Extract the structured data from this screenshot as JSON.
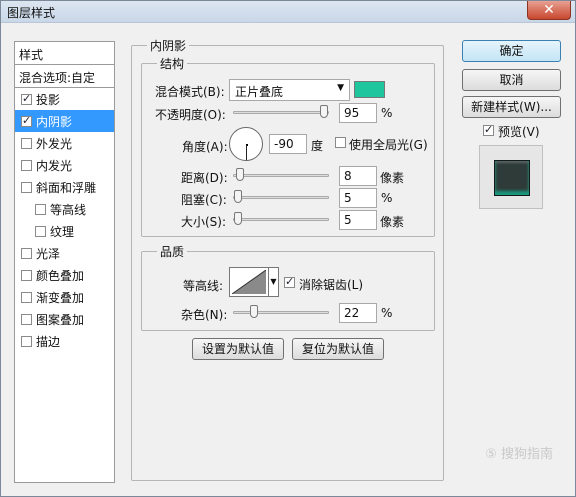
{
  "window": {
    "title": "图层样式",
    "close_label": "✕"
  },
  "sidebar": {
    "header": "样式",
    "blend_options": "混合选项:自定",
    "items": [
      {
        "label": "投影",
        "checked": true,
        "selected": false,
        "sub": false
      },
      {
        "label": "内阴影",
        "checked": true,
        "selected": true,
        "sub": false
      },
      {
        "label": "外发光",
        "checked": false,
        "selected": false,
        "sub": false
      },
      {
        "label": "内发光",
        "checked": false,
        "selected": false,
        "sub": false
      },
      {
        "label": "斜面和浮雕",
        "checked": false,
        "selected": false,
        "sub": false
      },
      {
        "label": "等高线",
        "checked": false,
        "selected": false,
        "sub": true
      },
      {
        "label": "纹理",
        "checked": false,
        "selected": false,
        "sub": true
      },
      {
        "label": "光泽",
        "checked": false,
        "selected": false,
        "sub": false
      },
      {
        "label": "颜色叠加",
        "checked": false,
        "selected": false,
        "sub": false
      },
      {
        "label": "渐变叠加",
        "checked": false,
        "selected": false,
        "sub": false
      },
      {
        "label": "图案叠加",
        "checked": false,
        "selected": false,
        "sub": false
      },
      {
        "label": "描边",
        "checked": false,
        "selected": false,
        "sub": false
      }
    ]
  },
  "inner_shadow": {
    "title": "内阴影",
    "structure": {
      "title": "结构",
      "blend_mode_label": "混合模式(B):",
      "blend_mode_value": "正片叠底",
      "blend_color": "#1fc59c",
      "opacity_label": "不透明度(O):",
      "opacity_value": "95",
      "opacity_unit": "%",
      "angle_label": "角度(A):",
      "angle_value": "-90",
      "angle_unit": "度",
      "global_light_label": "使用全局光(G)",
      "global_light_checked": false,
      "distance_label": "距离(D):",
      "distance_value": "8",
      "distance_unit": "像素",
      "choke_label": "阻塞(C):",
      "choke_value": "5",
      "choke_unit": "%",
      "size_label": "大小(S):",
      "size_value": "5",
      "size_unit": "像素"
    },
    "quality": {
      "title": "品质",
      "contour_label": "等高线:",
      "anti_alias_label": "消除锯齿(L)",
      "anti_alias_checked": true,
      "noise_label": "杂色(N):",
      "noise_value": "22",
      "noise_unit": "%"
    },
    "set_default_label": "设置为默认值",
    "reset_default_label": "复位为默认值"
  },
  "actions": {
    "ok_label": "确定",
    "cancel_label": "取消",
    "new_style_label": "新建样式(W)...",
    "preview_label": "预览(V)",
    "preview_checked": true
  },
  "watermark": "⑤ 搜狗指南"
}
